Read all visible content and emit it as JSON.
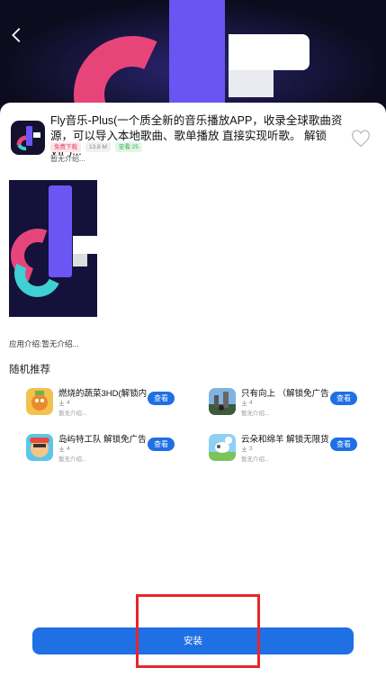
{
  "app": {
    "title": "Fly音乐-Plus(一个质全新的音乐播放APP，收录全球歌曲资源，可以导入本地歌曲、歌单播放 直接实现听歌。 解锁VIP)...",
    "tags": {
      "free": "免费下载",
      "size": "13.8 M",
      "safe": "安看:25"
    },
    "short_intro": "暂无介绍...",
    "full_intro": "应用介绍:暂无介绍..."
  },
  "recommend": {
    "title": "随机推荐",
    "items": [
      {
        "name": "燃烧的蔬菜3HD(解锁内",
        "downloads": "4",
        "desc": "暂无介绍...",
        "button": "查看"
      },
      {
        "name": "只有向上 （解锁免广告",
        "downloads": "4",
        "desc": "暂无介绍...",
        "button": "查看"
      },
      {
        "name": "岛屿特工队 解锁免广告",
        "downloads": "4",
        "desc": "暂无介绍...",
        "button": "查看"
      },
      {
        "name": "云朵和绵羊 解锁无限货",
        "downloads": "3",
        "desc": "暂无介绍...",
        "button": "查看"
      }
    ]
  },
  "install_label": "安装",
  "colors": {
    "accent": "#1f6fe5",
    "highlight_box": "#e8262b"
  },
  "icons": {
    "back": "back-arrow-icon",
    "favorite": "heart-outline-icon",
    "download": "download-icon"
  }
}
